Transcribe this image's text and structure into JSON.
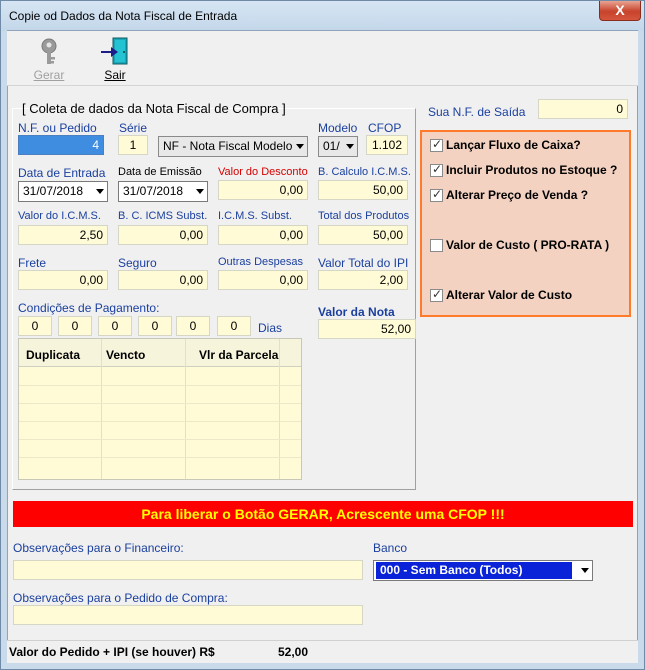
{
  "window": {
    "title": "Copie od Dados da Nota Fiscal de Entrada",
    "close_glyph": "X"
  },
  "toolbar": {
    "gerar_label": "Gerar",
    "sair_label": "Sair",
    "gerar_icon": "key-icon",
    "sair_icon": "exit-door-icon"
  },
  "sua_nf": {
    "label": "Sua N.F. de Saída",
    "value": "0"
  },
  "panel": {
    "title": "[ Coleta de dados da Nota Fiscal de Compra ]",
    "nf_label": "N.F. ou Pedido",
    "nf_value": "4",
    "serie_label": "Série",
    "serie_value": "1",
    "tipo_value": "NF - Nota Fiscal Modelo",
    "modelo_label": "Modelo",
    "modelo_value": "01/",
    "cfop_label": "CFOP",
    "cfop_value": "1.102",
    "data_entrada_label": "Data de Entrada",
    "data_entrada_value": "31/07/2018",
    "data_emissao_label": "Data de Emissão",
    "data_emissao_value": "31/07/2018",
    "valor_desconto_label": "Valor do Desconto",
    "valor_desconto_value": "0,00",
    "base_icms_label": "B. Calculo I.C.M.S.",
    "base_icms_value": "50,00",
    "valor_icms_label": "Valor do I.C.M.S.",
    "valor_icms_value": "2,50",
    "base_icms_st_label": "B. C. ICMS Subst.",
    "base_icms_st_value": "0,00",
    "icms_st_label": "I.C.M.S. Subst.",
    "icms_st_value": "0,00",
    "total_produtos_label": "Total dos Produtos",
    "total_produtos_value": "50,00",
    "frete_label": "Frete",
    "frete_value": "0,00",
    "seguro_label": "Seguro",
    "seguro_value": "0,00",
    "outras_label": "Outras Despesas",
    "outras_value": "0,00",
    "ipi_label": "Valor Total do IPI",
    "ipi_value": "2,00",
    "condicoes_label": "Condições de Pagamento:",
    "condicoes_values": [
      "0",
      "0",
      "0",
      "0",
      "0",
      "0"
    ],
    "dias_label": "Dias",
    "valor_nota_label": "Valor da Nota",
    "valor_nota_value": "52,00"
  },
  "grid": {
    "columns": [
      "Duplicata",
      "Vencto",
      "Vlr da Parcela"
    ],
    "rows": []
  },
  "options": [
    {
      "label": "Lançar Fluxo de Caixa?",
      "checked": true
    },
    {
      "label": "Incluir Produtos no Estoque ?",
      "checked": true
    },
    {
      "label": "Alterar Preço de Venda ?",
      "checked": true
    },
    {
      "label": "Valor de Custo ( PRO-RATA )",
      "checked": false
    },
    {
      "label": "Alterar Valor de Custo",
      "checked": true
    }
  ],
  "warning": "Para liberar o Botão GERAR, Acrescente uma CFOP !!!",
  "obs_financeiro_label": "Observações para o Financeiro:",
  "obs_financeiro_value": "",
  "banco_label": "Banco",
  "banco_value": "000 - Sem Banco (Todos)",
  "obs_pedido_label": "Observações para o Pedido de Compra:",
  "obs_pedido_value": "",
  "status": {
    "label": "Valor do Pedido + IPI (se houver) R$",
    "value": "52,00"
  },
  "colors": {
    "accent_orange": "#ff7a2b",
    "warning_bg": "#ff0000",
    "warning_text": "#ffff00",
    "field_bg": "#fffbd7",
    "label_blue": "#1a3f9e"
  }
}
